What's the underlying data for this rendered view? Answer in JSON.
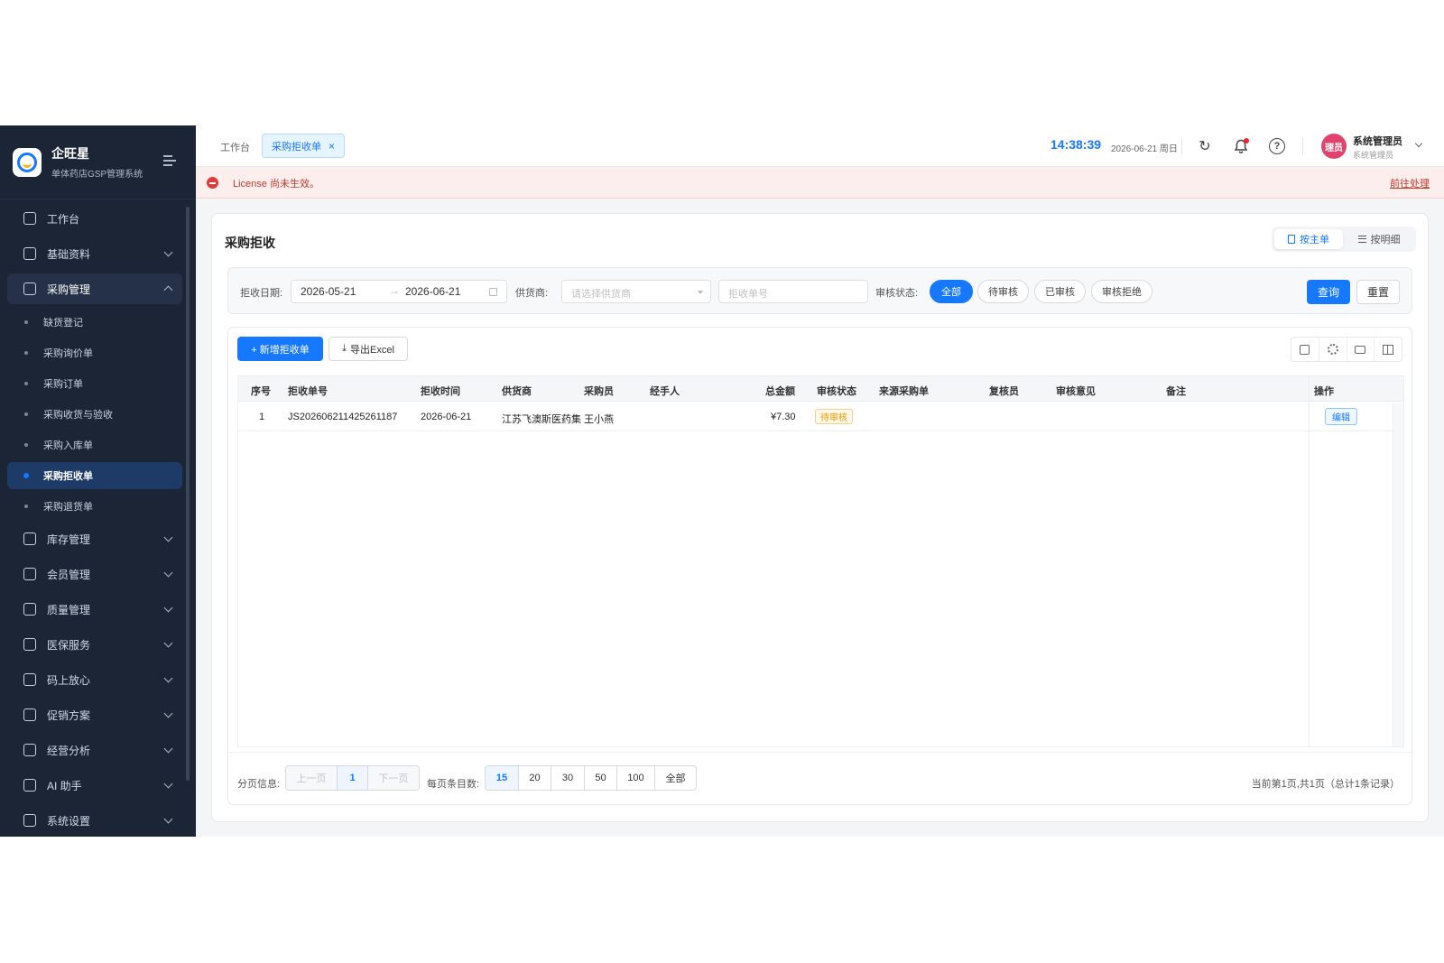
{
  "brand": {
    "name": "企旺星",
    "subtitle": "单体药店GSP管理系统"
  },
  "sidebar": {
    "items": [
      {
        "label": "工作台",
        "icon": "dashboard-icon"
      },
      {
        "label": "基础资料",
        "icon": "grid-icon"
      },
      {
        "label": "采购管理",
        "icon": "cart-icon",
        "open": true
      },
      {
        "label": "库存管理",
        "icon": "archive-icon"
      },
      {
        "label": "会员管理",
        "icon": "users-icon"
      },
      {
        "label": "质量管理",
        "icon": "check-circle-icon"
      },
      {
        "label": "医保服务",
        "icon": "shield-icon"
      },
      {
        "label": "码上放心",
        "icon": "scan-icon"
      },
      {
        "label": "促销方案",
        "icon": "tag-icon"
      },
      {
        "label": "经营分析",
        "icon": "chart-icon"
      },
      {
        "label": "AI 助手",
        "icon": "robot-icon"
      },
      {
        "label": "系统设置",
        "icon": "gear-icon"
      }
    ],
    "sub_items": [
      "缺货登记",
      "采购询价单",
      "采购订单",
      "采购收货与验收",
      "采购入库单",
      "采购拒收单",
      "采购退货单"
    ],
    "active_sub": "采购拒收单"
  },
  "header": {
    "tab_home": "工作台",
    "tab_active": "采购拒收单",
    "tab_close": "×",
    "time": "14:38:39",
    "date": "2026-06-21 周日",
    "avatar_text": "理员",
    "user_name": "系统管理员",
    "user_role": "系统管理员"
  },
  "alert": {
    "text": "License 尚未生效。",
    "link": "前往处理"
  },
  "main": {
    "title": "采购拒收",
    "view_main": "按主单",
    "view_detail": "按明细"
  },
  "filter": {
    "date_label": "拒收日期:",
    "date_start": "2026-05-21",
    "date_sep": "→",
    "date_end": "2026-06-21",
    "supplier_label": "供货商:",
    "supplier_placeholder": "请选择供货商",
    "order_placeholder": "拒收单号",
    "status_label": "审核状态:",
    "status_options": [
      "全部",
      "待审核",
      "已审核",
      "审核拒绝"
    ],
    "status_selected": "全部",
    "query_button": "查询",
    "reset_button": "重置"
  },
  "toolbar": {
    "add_button": "+ 新增拒收单",
    "export_button": "导出Excel"
  },
  "table": {
    "columns": [
      "序号",
      "拒收单号",
      "拒收时间",
      "供货商",
      "采购员",
      "经手人",
      "总金额",
      "审核状态",
      "来源采购单",
      "复核员",
      "审核意见",
      "备注",
      "操作"
    ],
    "rows": [
      {
        "index": "1",
        "order_no": "JS202606211425261187",
        "time": "2026-06-21",
        "supplier": "江苏飞澳斯医药集",
        "buyer": "王小燕",
        "handler": "",
        "amount": "¥7.30",
        "status": "待审核",
        "source": "",
        "reviewer": "",
        "opinion": "",
        "remark": "",
        "action": "编辑"
      }
    ]
  },
  "pager": {
    "info_label": "分页信息:",
    "prev": "上一页",
    "current": "1",
    "next": "下一页",
    "size_label": "每页条目数:",
    "sizes": [
      "15",
      "20",
      "30",
      "50",
      "100",
      "全部"
    ],
    "size_selected": "15",
    "summary": "当前第1页,共1页（总计1条记录）"
  },
  "colors": {
    "primary": "#1677ff",
    "sidebar_bg": "#1b2536",
    "alert_bg": "#fdeeee",
    "warn": "#e59b00"
  }
}
